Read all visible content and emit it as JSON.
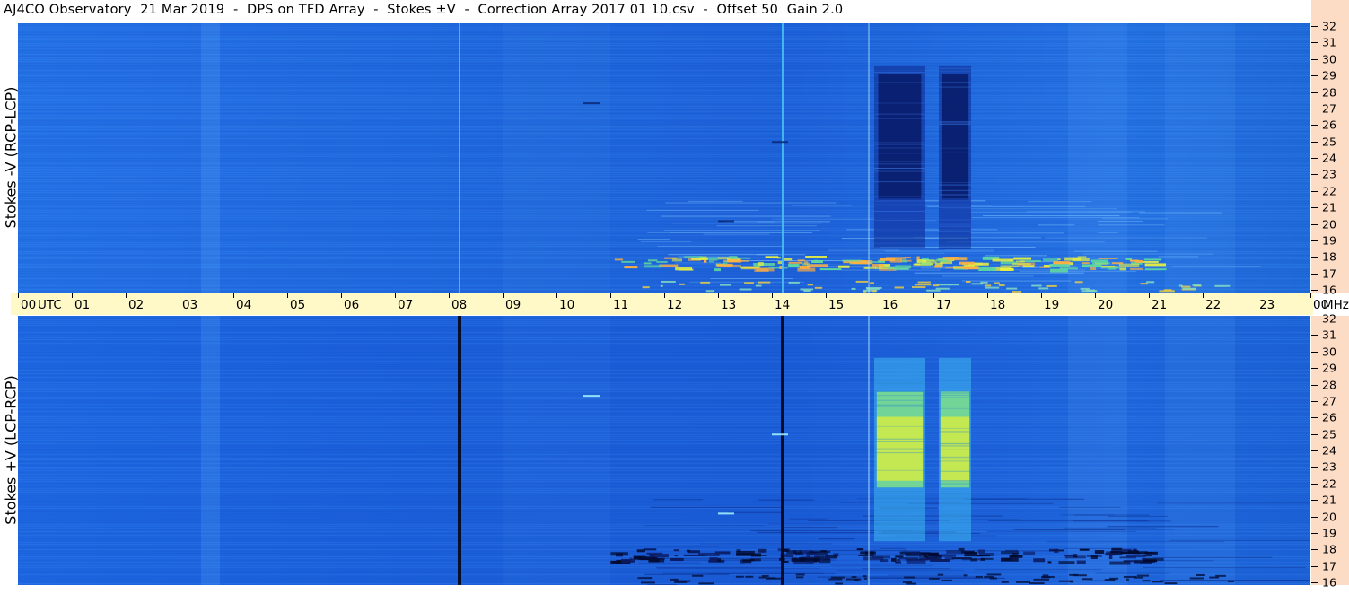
{
  "title": "AJ4CO Observatory  21 Mar 2019  -  DPS on TFD Array  -  Stokes ±V  -  Correction Array 2017 01 10.csv  -  Offset 50  Gain 2.0",
  "chart_data": [
    {
      "type": "heatmap",
      "name": "Stokes -V (RCP-LCP)",
      "ylabel": "Stokes -V (RCP-LCP)",
      "x_labels": [
        "00",
        "01",
        "02",
        "03",
        "04",
        "05",
        "06",
        "07",
        "08",
        "09",
        "10",
        "11",
        "12",
        "13",
        "14",
        "15",
        "16",
        "17",
        "18",
        "19",
        "20",
        "21",
        "22",
        "23",
        "00"
      ],
      "x_unit": "UTC",
      "y_labels": [
        "16",
        "17",
        "18",
        "19",
        "20",
        "21",
        "22",
        "23",
        "24",
        "25",
        "26",
        "27",
        "28",
        "29",
        "30",
        "31",
        "32"
      ],
      "y_unit": "MHz",
      "ylim": [
        16,
        32
      ],
      "features": {
        "strong_regions_hours": [
          [
            15.9,
            16.85
          ],
          [
            17.1,
            17.7
          ]
        ],
        "strong_regions_sign": "negative (dark)",
        "bright_band_mhz": [
          17.4,
          18.2
        ],
        "vertical_lines_hours": [
          8.2,
          14.2,
          15.8
        ]
      }
    },
    {
      "type": "heatmap",
      "name": "Stokes +V (LCP-RCP)",
      "ylabel": "Stokes +V (LCP-RCP)",
      "x_labels": [
        "00",
        "01",
        "02",
        "03",
        "04",
        "05",
        "06",
        "07",
        "08",
        "09",
        "10",
        "11",
        "12",
        "13",
        "14",
        "15",
        "16",
        "17",
        "18",
        "19",
        "20",
        "21",
        "22",
        "23",
        "00"
      ],
      "x_unit": "UTC",
      "y_labels": [
        "16",
        "17",
        "18",
        "19",
        "20",
        "21",
        "22",
        "23",
        "24",
        "25",
        "26",
        "27",
        "28",
        "29",
        "30",
        "31",
        "32"
      ],
      "y_unit": "MHz",
      "ylim": [
        16,
        32
      ],
      "features": {
        "strong_regions_hours": [
          [
            15.9,
            16.85
          ],
          [
            17.1,
            17.7
          ]
        ],
        "strong_regions_sign": "positive (yellow-green)",
        "dark_band_mhz": [
          17.4,
          18.2
        ],
        "vertical_lines_hours": [
          8.2,
          14.2,
          15.8
        ]
      }
    }
  ],
  "colors": {
    "base": "#1a63e0",
    "band_yellow": "#d8ec40",
    "band_green": "#6ad690",
    "band_dark": "#0a1560",
    "time_axis_bg": "#fff9c8",
    "freq_axis_bg": "#fddcc6"
  }
}
